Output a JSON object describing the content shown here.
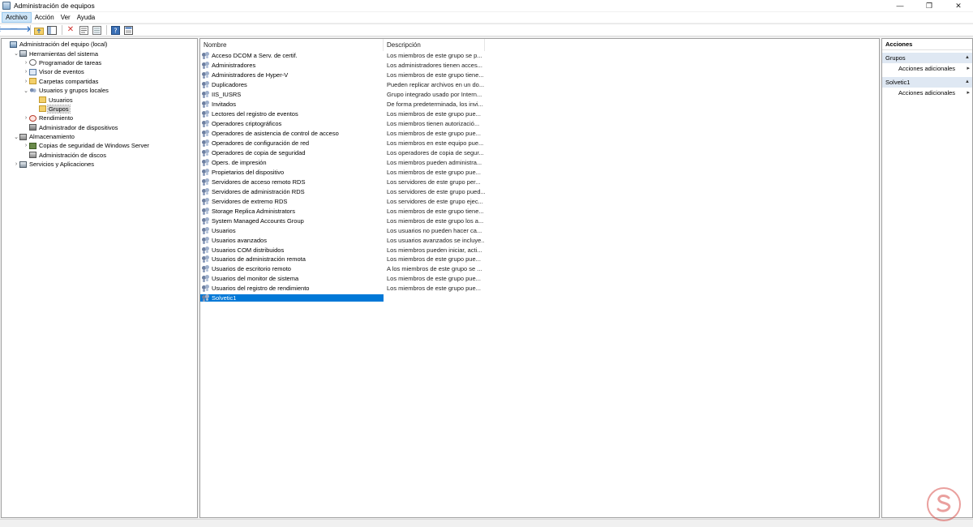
{
  "window": {
    "title": "Administración de equipos",
    "min": "—",
    "restore": "❐",
    "close": "✕"
  },
  "menu": [
    "Archivo",
    "Acción",
    "Ver",
    "Ayuda"
  ],
  "tree": [
    {
      "label": "Administración del equipo (local)",
      "level": 0,
      "exp": "",
      "icon": "computer-icon",
      "cls": "ic-comp"
    },
    {
      "label": "Herramientas del sistema",
      "level": 1,
      "exp": "⌄",
      "icon": "tools-icon",
      "cls": "ic-tools"
    },
    {
      "label": "Programador de tareas",
      "level": 2,
      "exp": "›",
      "icon": "clock-icon",
      "cls": "ic-clock"
    },
    {
      "label": "Visor de eventos",
      "level": 2,
      "exp": "›",
      "icon": "event-viewer-icon",
      "cls": "ic-event"
    },
    {
      "label": "Carpetas compartidas",
      "level": 2,
      "exp": "›",
      "icon": "shared-folder-icon",
      "cls": "ic-folder"
    },
    {
      "label": "Usuarios y grupos locales",
      "level": 2,
      "exp": "⌄",
      "icon": "users-icon",
      "cls": "ic-users"
    },
    {
      "label": "Usuarios",
      "level": 3,
      "exp": "",
      "icon": "folder-icon",
      "cls": "ic-folder"
    },
    {
      "label": "Grupos",
      "level": 3,
      "exp": "",
      "icon": "folder-icon",
      "cls": "ic-folder",
      "selected": true
    },
    {
      "label": "Rendimiento",
      "level": 2,
      "exp": "›",
      "icon": "performance-icon",
      "cls": "ic-perf"
    },
    {
      "label": "Administrador de dispositivos",
      "level": 2,
      "exp": "",
      "icon": "device-manager-icon",
      "cls": "ic-dev"
    },
    {
      "label": "Almacenamiento",
      "level": 1,
      "exp": "⌄",
      "icon": "storage-icon",
      "cls": "ic-store"
    },
    {
      "label": "Copias de seguridad de Windows Server",
      "level": 2,
      "exp": "›",
      "icon": "backup-icon",
      "cls": "ic-backup"
    },
    {
      "label": "Administración de discos",
      "level": 2,
      "exp": "",
      "icon": "disk-icon",
      "cls": "ic-disk"
    },
    {
      "label": "Servicios y Aplicaciones",
      "level": 1,
      "exp": "›",
      "icon": "services-icon",
      "cls": "ic-svc"
    }
  ],
  "list": {
    "columns": {
      "name": "Nombre",
      "description": "Descripción"
    },
    "rows": [
      {
        "name": "Acceso DCOM a Serv. de certif.",
        "description": "Los miembros de este grupo se p..."
      },
      {
        "name": "Administradores",
        "description": "Los administradores tienen acces..."
      },
      {
        "name": "Administradores de Hyper-V",
        "description": "Los miembros de este grupo tiene..."
      },
      {
        "name": "Duplicadores",
        "description": "Pueden replicar archivos en un do..."
      },
      {
        "name": "IIS_IUSRS",
        "description": "Grupo integrado usado por Intern..."
      },
      {
        "name": "Invitados",
        "description": "De forma predeterminada, los invi..."
      },
      {
        "name": "Lectores del registro de eventos",
        "description": "Los miembros de este grupo pue..."
      },
      {
        "name": "Operadores criptográficos",
        "description": "Los miembros tienen autorizació..."
      },
      {
        "name": "Operadores de asistencia de control de acceso",
        "description": "Los miembros de este grupo pue..."
      },
      {
        "name": "Operadores de configuración de red",
        "description": "Los miembros en este equipo pue..."
      },
      {
        "name": "Operadores de copia de seguridad",
        "description": "Los operadores de copia de segur..."
      },
      {
        "name": "Opers. de impresión",
        "description": "Los miembros pueden administra..."
      },
      {
        "name": "Propietarios del dispositivo",
        "description": "Los miembros de este grupo pue..."
      },
      {
        "name": "Servidores de acceso remoto RDS",
        "description": "Los servidores de este grupo per..."
      },
      {
        "name": "Servidores de administración RDS",
        "description": "Los servidores de este grupo pued..."
      },
      {
        "name": "Servidores de extremo RDS",
        "description": "Los servidores de este grupo ejec..."
      },
      {
        "name": "Storage Replica Administrators",
        "description": "Los miembros de este grupo tiene..."
      },
      {
        "name": "System Managed Accounts Group",
        "description": "Los miembros de este grupo los a..."
      },
      {
        "name": "Usuarios",
        "description": "Los usuarios no pueden hacer ca..."
      },
      {
        "name": "Usuarios avanzados",
        "description": "Los usuarios avanzados se incluye..."
      },
      {
        "name": "Usuarios COM distribuidos",
        "description": "Los miembros pueden iniciar, acti..."
      },
      {
        "name": "Usuarios de administración remota",
        "description": "Los miembros de este grupo pue..."
      },
      {
        "name": "Usuarios de escritorio remoto",
        "description": "A los miembros de este grupo se ..."
      },
      {
        "name": "Usuarios del monitor de sistema",
        "description": "Los miembros de este grupo pue..."
      },
      {
        "name": "Usuarios del registro de rendimiento",
        "description": "Los miembros de este grupo pue..."
      },
      {
        "name": "Solvetic1",
        "description": "",
        "selected": true
      }
    ]
  },
  "actions": {
    "header": "Acciones",
    "sections": [
      {
        "title": "Grupos",
        "items": [
          "Acciones adicionales"
        ]
      },
      {
        "title": "Solvetic1",
        "items": [
          "Acciones adicionales"
        ]
      }
    ]
  },
  "colors": {
    "selection": "#0078d7",
    "section_bg": "#dfe8f3",
    "watermark": "#d9534f"
  }
}
